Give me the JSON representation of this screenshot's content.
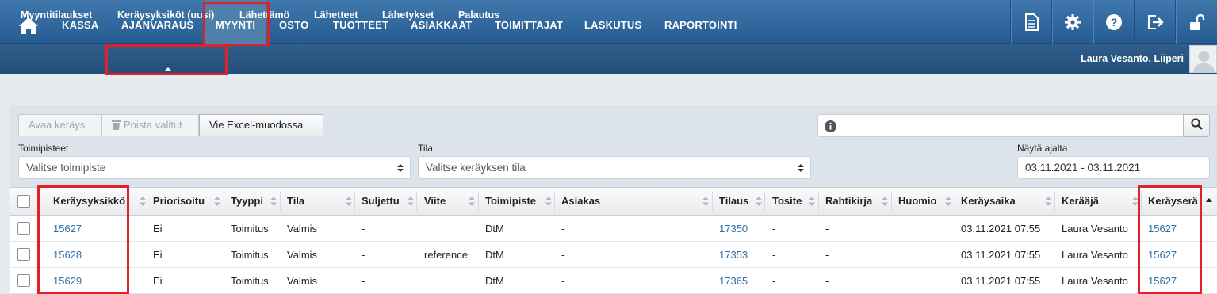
{
  "topnav": {
    "items": [
      "KASSA",
      "AJANVARAUS",
      "MYYNTI",
      "OSTO",
      "TUOTTEET",
      "ASIAKKAAT",
      "TOIMITTAJAT",
      "LASKUTUS",
      "RAPORTOINTI"
    ],
    "active": "MYYNTI",
    "icons": [
      "home-icon",
      "document-icon",
      "gear-icon",
      "help-icon",
      "logout-icon",
      "unlock-icon"
    ]
  },
  "subnav": {
    "items": [
      "Myyntitilaukset",
      "Keräysyksiköt (uusi)",
      "Lähettämö",
      "Lähetteet",
      "Lähetykset",
      "Palautus"
    ],
    "active": "Keräysyksiköt (uusi)",
    "user": "Laura Vesanto, Liiperi"
  },
  "toolbar": {
    "open_label": "Avaa keräys",
    "delete_label": "Poista valitut",
    "excel_label": "Vie Excel-muodossa"
  },
  "filters": {
    "site_label": "Toimipisteet",
    "site_placeholder": "Valitse toimipiste",
    "state_label": "Tila",
    "state_placeholder": "Valitse keräyksen tila",
    "date_label": "Näytä ajalta",
    "date_value": "03.11.2021 - 03.11.2021"
  },
  "table": {
    "columns": [
      "Keräysyksikkö",
      "Priorisoitu",
      "Tyyppi",
      "Tila",
      "Suljettu",
      "Viite",
      "Toimipiste",
      "Asiakas",
      "Tilaus",
      "Tosite",
      "Rahtikirja",
      "Huomio",
      "Keräysaika",
      "Kerääjä",
      "Keräyserä"
    ],
    "rows": [
      [
        "15627",
        "Ei",
        "Toimitus",
        "Valmis",
        "-",
        "",
        "DtM",
        "-",
        "17350",
        "-",
        "-",
        "",
        "03.11.2021 07:55",
        "Laura Vesanto",
        "15627"
      ],
      [
        "15628",
        "Ei",
        "Toimitus",
        "Valmis",
        "-",
        "reference",
        "DtM",
        "-",
        "17353",
        "-",
        "-",
        "",
        "03.11.2021 07:55",
        "Laura Vesanto",
        "15627"
      ],
      [
        "15629",
        "Ei",
        "Toimitus",
        "Valmis",
        "-",
        "",
        "DtM",
        "-",
        "17365",
        "-",
        "-",
        "",
        "03.11.2021 07:55",
        "Laura Vesanto",
        "15627"
      ]
    ]
  },
  "colors": {
    "nav_blue": "#2f6aa3",
    "subnav_blue": "#2a5885",
    "link": "#2f6fa8",
    "highlight_red": "#e1202b"
  }
}
